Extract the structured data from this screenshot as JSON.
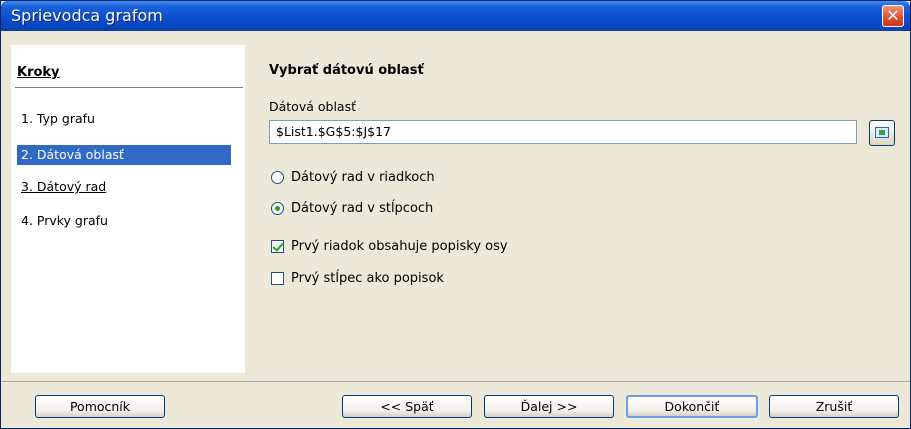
{
  "window": {
    "title": "Sprievodca grafom",
    "close_glyph": "✕"
  },
  "steps": {
    "heading": "Kroky",
    "items": [
      {
        "label": "1. Typ grafu",
        "selected": false
      },
      {
        "label": "2. Dátová oblasť",
        "selected": true
      },
      {
        "label": "3. Dátový rad",
        "selected": false
      },
      {
        "label": "4. Prvky grafu",
        "selected": false
      }
    ]
  },
  "main": {
    "heading": "Vybrať dátovú oblasť",
    "range_label": "Dátová oblasť",
    "range_value": "$List1.$G$5:$J$17",
    "radios": [
      {
        "label": "Dátový rad v riadkoch",
        "checked": false
      },
      {
        "label": "Dátový rad v stĺpcoch",
        "checked": true
      }
    ],
    "checkboxes": [
      {
        "label": "Prvý riadok obsahuje popisky osy",
        "checked": true
      },
      {
        "label": "Prvý stĺpec ako popisok",
        "checked": false
      }
    ]
  },
  "buttons": {
    "help": "Pomocník",
    "back": "<< Späť",
    "next": "Ďalej >>",
    "finish": "Dokončiť",
    "cancel": "Zrušiť"
  },
  "colors": {
    "title_bar": "#0a4fd0",
    "selection": "#316ac5",
    "dialog_bg": "#ece9d8",
    "close": "#e0583a"
  },
  "icons": {
    "close": "close-icon",
    "range_picker": "shrink-range-icon"
  }
}
